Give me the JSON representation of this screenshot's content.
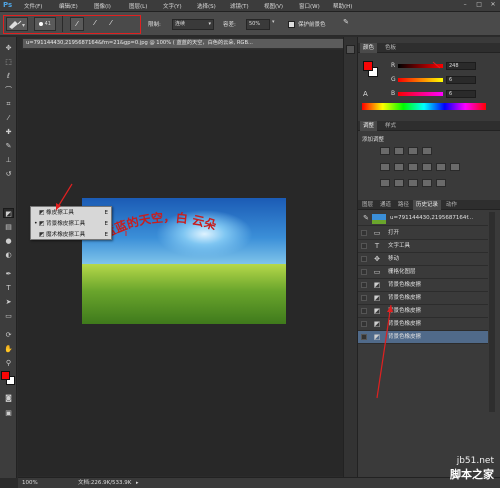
{
  "app": {
    "logo": "Ps"
  },
  "menu": [
    "文件(F)",
    "编辑(E)",
    "图像(I)",
    "图层(L)",
    "文字(Y)",
    "选择(S)",
    "滤镜(T)",
    "视图(V)",
    "窗口(W)",
    "帮助(H)"
  ],
  "window_controls": [
    "–",
    "□",
    "✕"
  ],
  "options": {
    "brush_size": "41",
    "sampling_label": "限制:",
    "sampling_value": "连续",
    "tolerance_label": "容差:",
    "tolerance_value": "50%",
    "protect_label": "保护前景色"
  },
  "doc_tab": {
    "title": "u=791144430,2195687164&fm=21&gp=0.jpg @ 100% ( 蓝蓝的天空，白色的云朵, RGB...",
    "close": "×"
  },
  "canvas_text": "蓝蓝的天空，白     云朵",
  "flyout": [
    {
      "label": "橡皮擦工具",
      "key": "E",
      "icon": "eraser-icon",
      "selected": false
    },
    {
      "label": "背景橡皮擦工具",
      "key": "E",
      "icon": "background-eraser-icon",
      "selected": true
    },
    {
      "label": "魔术橡皮擦工具",
      "key": "E",
      "icon": "magic-eraser-icon",
      "selected": false
    }
  ],
  "color_panel": {
    "tabs": [
      "颜色",
      "色板"
    ],
    "r_label": "R",
    "r_value": "248",
    "g_label": "G",
    "g_value": "6",
    "b_label": "B",
    "b_value": "6"
  },
  "adjust_panel": {
    "tabs": [
      "调整",
      "样式"
    ],
    "title": "添加调整"
  },
  "history_panel": {
    "tabs": [
      "图层",
      "通道",
      "路径",
      "历史记录",
      "动作"
    ],
    "snapshot": "u=791144430,2195687164f...",
    "items": [
      {
        "icon": "open-icon",
        "label": "打开"
      },
      {
        "icon": "text-tool-icon",
        "label": "文字工具"
      },
      {
        "icon": "move-icon",
        "label": "移动"
      },
      {
        "icon": "rasterize-icon",
        "label": "栅格化图层"
      },
      {
        "icon": "background-eraser-icon",
        "label": "背景色橡皮擦"
      },
      {
        "icon": "background-eraser-icon",
        "label": "背景色橡皮擦"
      },
      {
        "icon": "background-eraser-icon",
        "label": "背景色橡皮擦"
      },
      {
        "icon": "background-eraser-icon",
        "label": "背景色橡皮擦"
      },
      {
        "icon": "background-eraser-icon",
        "label": "背景色橡皮擦"
      }
    ]
  },
  "status": {
    "zoom": "100%",
    "doc_size": "文档:226.9K/533.9K"
  },
  "watermark": {
    "line1": "jb51.net",
    "line2": "脚本之家"
  },
  "colors": {
    "foreground": "#f80606",
    "background": "#ffffff",
    "annotation": "#e02020",
    "selected_row": "#506a8a"
  }
}
